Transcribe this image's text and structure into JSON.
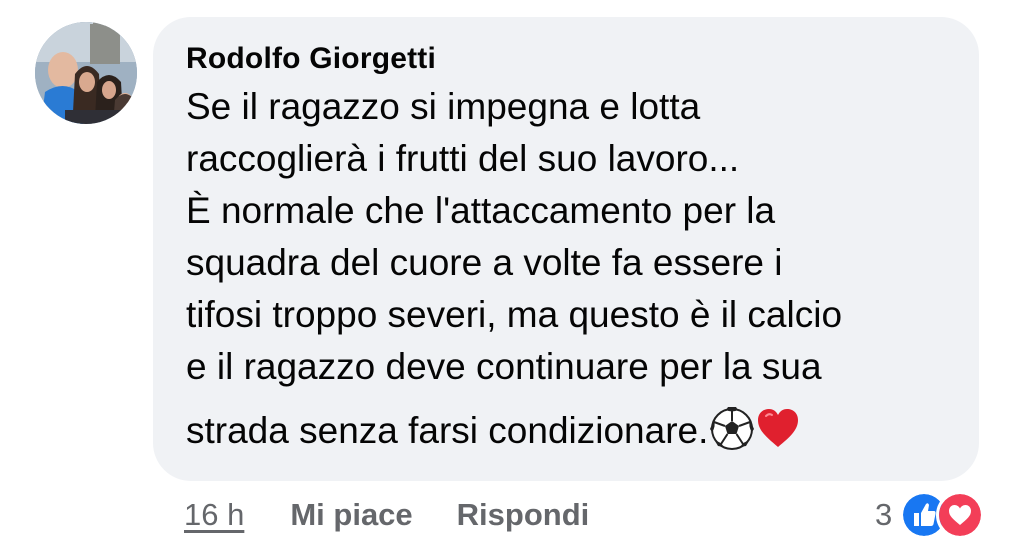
{
  "comment": {
    "author": "Rodolfo Giorgetti",
    "lines": [
      "Se il ragazzo si impegna e lotta",
      "raccoglierà i frutti del suo lavoro...",
      "È normale che l'attaccamento per la",
      "squadra del cuore a volte fa essere i",
      "tifosi troppo severi, ma questo è il calcio",
      "e il ragazzo deve continuare per la sua",
      "strada senza farsi condizionare."
    ],
    "trailing_emojis": [
      "soccer-ball",
      "red-heart"
    ]
  },
  "actions": {
    "time": "16 h",
    "like_label": "Mi piace",
    "reply_label": "Rispondi"
  },
  "reactions": {
    "count": "3",
    "types": [
      "like",
      "love"
    ]
  },
  "colors": {
    "bubble": "#f0f2f5",
    "text": "#050505",
    "meta": "#65676b",
    "like": "#1877f2",
    "love": "#f33e58"
  }
}
